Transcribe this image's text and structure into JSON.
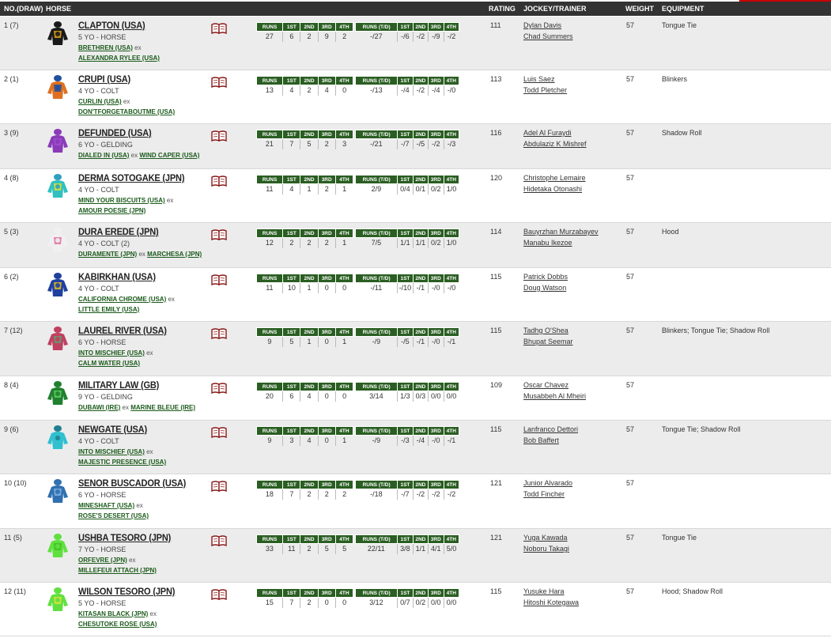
{
  "header": {
    "no_draw": "NO.(DRAW)",
    "horse": "HORSE",
    "rating": "RATING",
    "jockey_trainer": "JOCKEY/TRAINER",
    "weight": "WEIGHT",
    "equipment": "EQUIPMENT"
  },
  "stat_headers": {
    "runs": "RUNS",
    "runs_td": "RUNS (T/D)",
    "p1": "1ST",
    "p2": "2ND",
    "p3": "3RD",
    "p4": "4TH"
  },
  "ex_word": "ex",
  "horses": [
    {
      "no": "1 (7)",
      "name": "CLAPTON (USA)",
      "age": "5 YO - HORSE",
      "sire": "BRETHREN (USA)",
      "dam": "ALEXANDRA RYLEE (USA)",
      "split": true,
      "runs": [
        "27",
        "6",
        "2",
        "9",
        "2"
      ],
      "td": [
        "-/27",
        "-/6",
        "-/2",
        "-/9",
        "-/2"
      ],
      "rating": "111",
      "jockey": "Dylan Davis",
      "trainer": "Chad Summers",
      "weight": "57",
      "equipment": "Tongue Tie",
      "silk": [
        "#1a1a1a",
        "#e0a020",
        "#1a1a1a"
      ]
    },
    {
      "no": "2 (1)",
      "name": "CRUPI (USA)",
      "age": "4 YO - COLT",
      "sire": "CURLIN (USA)",
      "dam": "DON'TFORGETABOUTME (USA)",
      "split": true,
      "runs": [
        "13",
        "4",
        "2",
        "4",
        "0"
      ],
      "td": [
        "-/13",
        "-/4",
        "-/2",
        "-/4",
        "-/0"
      ],
      "rating": "113",
      "jockey": "Luis Saez",
      "trainer": "Todd Pletcher",
      "weight": "57",
      "equipment": "Blinkers",
      "silk": [
        "#e07020",
        "#2050a0",
        "#2050a0"
      ]
    },
    {
      "no": "3 (9)",
      "name": "DEFUNDED (USA)",
      "age": "6 YO - GELDING",
      "sire": "DIALED IN (USA)",
      "dam": "WIND CAPER (USA)",
      "split": false,
      "runs": [
        "21",
        "7",
        "5",
        "2",
        "3"
      ],
      "td": [
        "-/21",
        "-/7",
        "-/5",
        "-/2",
        "-/3"
      ],
      "rating": "116",
      "jockey": "Adel Al Furaydi",
      "trainer": "Abdulaziz K Mishref",
      "weight": "57",
      "equipment": "Shadow Roll",
      "silk": [
        "#8a3ab8",
        "#a050d0",
        "#8a3ab8"
      ]
    },
    {
      "no": "4 (8)",
      "name": "DERMA SOTOGAKE (JPN)",
      "age": "4 YO - COLT",
      "sire": "MIND YOUR BISCUITS (USA)",
      "dam": "AMOUR POESIE (JPN)",
      "split": true,
      "runs": [
        "11",
        "4",
        "1",
        "2",
        "1"
      ],
      "td": [
        "2/9",
        "0/4",
        "0/1",
        "0/2",
        "1/0"
      ],
      "rating": "120",
      "jockey": "Christophe Lemaire",
      "trainer": "Hidetaka Otonashi",
      "weight": "57",
      "equipment": "",
      "silk": [
        "#30c0c0",
        "#e0e030",
        "#30a0c0"
      ]
    },
    {
      "no": "5 (3)",
      "name": "DURA EREDE (JPN)",
      "age": "4 YO - COLT (2)",
      "sire": "DURAMENTE (JPN)",
      "dam": "MARCHESA (JPN)",
      "split": false,
      "runs": [
        "12",
        "2",
        "2",
        "2",
        "1"
      ],
      "td": [
        "7/5",
        "1/1",
        "1/1",
        "0/2",
        "1/0"
      ],
      "rating": "114",
      "jockey": "Bauyrzhan Murzabayev",
      "trainer": "Manabu Ikezoe",
      "weight": "57",
      "equipment": "Hood",
      "silk": [
        "#f0f0f0",
        "#e070a0",
        "#f0f0f0"
      ]
    },
    {
      "no": "6 (2)",
      "name": "KABIRKHAN (USA)",
      "age": "4 YO - COLT",
      "sire": "CALIFORNIA CHROME (USA)",
      "dam": "LITTLE EMILY (USA)",
      "split": true,
      "runs": [
        "11",
        "10",
        "1",
        "0",
        "0"
      ],
      "td": [
        "-/11",
        "-/10",
        "-/1",
        "-/0",
        "-/0"
      ],
      "rating": "115",
      "jockey": "Patrick Dobbs",
      "trainer": "Doug Watson",
      "weight": "57",
      "equipment": "",
      "silk": [
        "#2040a0",
        "#e0c020",
        "#2040a0"
      ]
    },
    {
      "no": "7 (12)",
      "name": "LAUREL RIVER (USA)",
      "age": "6 YO - HORSE",
      "sire": "INTO MISCHIEF (USA)",
      "dam": "CALM WATER (USA)",
      "split": true,
      "runs": [
        "9",
        "5",
        "1",
        "0",
        "1"
      ],
      "td": [
        "-/9",
        "-/5",
        "-/1",
        "-/0",
        "-/1"
      ],
      "rating": "115",
      "jockey": "Tadhg O'Shea",
      "trainer": "Bhupat Seemar",
      "weight": "57",
      "equipment": "Blinkers; Tongue Tie; Shadow Roll",
      "silk": [
        "#c04060",
        "#60a070",
        "#c04060"
      ]
    },
    {
      "no": "8 (4)",
      "name": "MILITARY LAW (GB)",
      "age": "9 YO - GELDING",
      "sire": "DUBAWI (IRE)",
      "dam": "MARINE BLEUE (IRE)",
      "split": false,
      "runs": [
        "20",
        "6",
        "4",
        "0",
        "0"
      ],
      "td": [
        "3/14",
        "1/3",
        "0/3",
        "0/0",
        "0/0"
      ],
      "rating": "109",
      "jockey": "Oscar Chavez",
      "trainer": "Musabbeh Al Mheiri",
      "weight": "57",
      "equipment": "",
      "silk": [
        "#208030",
        "#60d060",
        "#208030"
      ]
    },
    {
      "no": "9 (6)",
      "name": "NEWGATE (USA)",
      "age": "4 YO - COLT",
      "sire": "INTO MISCHIEF (USA)",
      "dam": "MAJESTIC PRESENCE (USA)",
      "split": true,
      "runs": [
        "9",
        "3",
        "4",
        "0",
        "1"
      ],
      "td": [
        "-/9",
        "-/3",
        "-/4",
        "-/0",
        "-/1"
      ],
      "rating": "115",
      "jockey": "Lanfranco Dettori",
      "trainer": "Bob Baffert",
      "weight": "57",
      "equipment": "Tongue Tie; Shadow Roll",
      "silk": [
        "#30c0d0",
        "#30c0d0",
        "#208090"
      ]
    },
    {
      "no": "10 (10)",
      "name": "SENOR BUSCADOR (USA)",
      "age": "6 YO - HORSE",
      "sire": "MINESHAFT (USA)",
      "dam": "ROSE'S DESERT (USA)",
      "split": true,
      "runs": [
        "18",
        "7",
        "2",
        "2",
        "2"
      ],
      "td": [
        "-/18",
        "-/7",
        "-/2",
        "-/2",
        "-/2"
      ],
      "rating": "121",
      "jockey": "Junior Alvarado",
      "trainer": "Todd Fincher",
      "weight": "57",
      "equipment": "",
      "silk": [
        "#3070b0",
        "#80b0e0",
        "#3070b0"
      ]
    },
    {
      "no": "11 (5)",
      "name": "USHBA TESORO (JPN)",
      "age": "7 YO - HORSE",
      "sire": "ORFEVRE (JPN)",
      "dam": "MILLEFEUI ATTACH (JPN)",
      "split": true,
      "runs": [
        "33",
        "11",
        "2",
        "5",
        "5"
      ],
      "td": [
        "22/11",
        "3/8",
        "1/1",
        "4/1",
        "5/0"
      ],
      "rating": "121",
      "jockey": "Yuga Kawada",
      "trainer": "Noboru Takagi",
      "weight": "57",
      "equipment": "Tongue Tie",
      "silk": [
        "#60e040",
        "#40c020",
        "#60e040"
      ]
    },
    {
      "no": "12 (11)",
      "name": "WILSON TESORO (JPN)",
      "age": "5 YO - HORSE",
      "sire": "KITASAN BLACK (JPN)",
      "dam": "CHESUTOKE ROSE (USA)",
      "split": true,
      "runs": [
        "15",
        "7",
        "2",
        "0",
        "0"
      ],
      "td": [
        "3/12",
        "0/7",
        "0/2",
        "0/0",
        "0/0"
      ],
      "rating": "115",
      "jockey": "Yusuke Hara",
      "trainer": "Hitoshi Kotegawa",
      "weight": "57",
      "equipment": "Hood; Shadow Roll",
      "silk": [
        "#60e040",
        "#e0e040",
        "#60e040"
      ]
    }
  ]
}
